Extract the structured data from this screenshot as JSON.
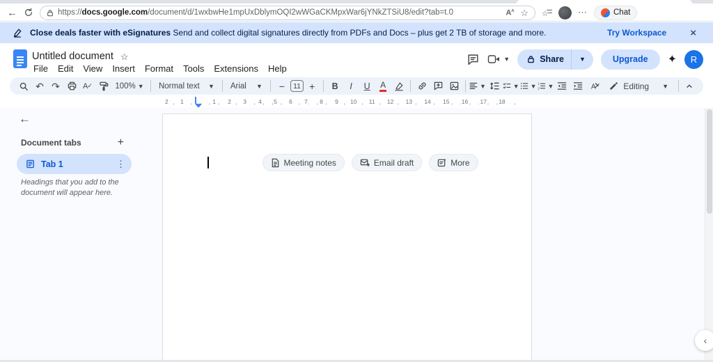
{
  "browser": {
    "url": {
      "scheme": "https://",
      "domain": "docs.google.com",
      "path": "/document/d/1wxbwHe1mpUxDblymOQI2wWGaCKMpxWar6jYNkZTSiU8/edit?tab=t.0"
    },
    "chat_label": "Chat"
  },
  "banner": {
    "title_bold": "Close deals faster with eSignatures",
    "message": "Send and collect digital signatures directly from PDFs and Docs – plus get 2 TB of storage and more.",
    "cta_label": "Try Workspace",
    "close_icon": "×"
  },
  "header": {
    "title": "Untitled document",
    "menus": [
      "File",
      "Edit",
      "View",
      "Insert",
      "Format",
      "Tools",
      "Extensions",
      "Help"
    ],
    "share_label": "Share",
    "upgrade_label": "Upgrade",
    "avatar_initial": "R"
  },
  "toolbar": {
    "zoom": "100%",
    "styles": "Normal text",
    "font": "Arial",
    "minus": "−",
    "font_size": "11",
    "plus": "+",
    "bold": "B",
    "italic": "I",
    "underline": "U",
    "text_color": "A",
    "mode": "Editing"
  },
  "ruler": {
    "left_marks": [
      "2",
      "1"
    ],
    "marks": [
      "1",
      "2",
      "3",
      "4",
      "5",
      "6",
      "7",
      "8",
      "9",
      "10",
      "11",
      "12",
      "13",
      "14",
      "15",
      "16",
      "17",
      "18"
    ]
  },
  "sidebar": {
    "section_title": "Document tabs",
    "add_icon": "+",
    "tab": {
      "label": "Tab 1"
    },
    "hint": "Headings that you add to the document will appear here."
  },
  "page": {
    "suggestions": [
      {
        "label": "Meeting notes"
      },
      {
        "label": "Email draft"
      },
      {
        "label": "More"
      }
    ]
  },
  "colors": {
    "accent_blue": "#0b57d0",
    "banner_bg": "#d3e3fd",
    "toolbar_bg": "#edf2fa",
    "selected_tab_bg": "#d3e3fd",
    "docs_logo_blue": "#3a86f4",
    "avatar_bg": "#1a73e8",
    "text_color_underline_red": "#d93025",
    "ruler_marker_blue": "#4285f4"
  }
}
